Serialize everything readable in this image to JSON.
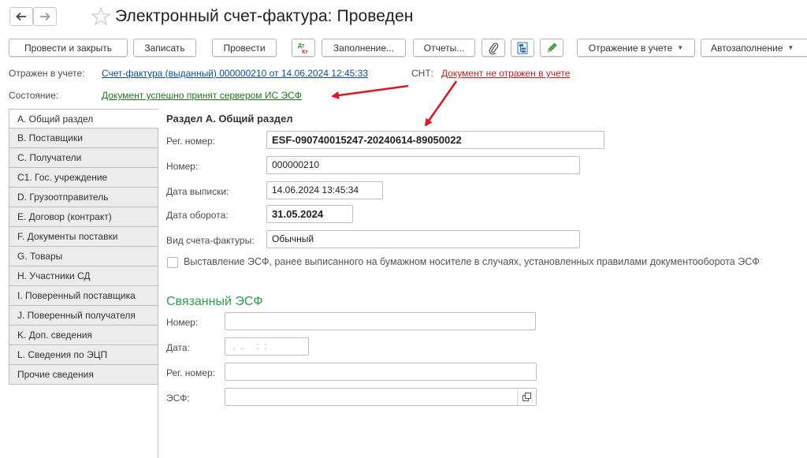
{
  "window": {
    "title": "Электронный счет-фактура: Проведен",
    "nav_back_icon": "arrow-left-icon",
    "nav_forward_icon": "arrow-right-icon",
    "favorite_icon": "star-icon"
  },
  "toolbar": {
    "post_close": "Провести и закрыть",
    "save": "Записать",
    "post": "Провести",
    "fill": "Заполнение...",
    "reports": "Отчеты...",
    "accounting": "Отражение в учете",
    "autofill": "Автозаполнение"
  },
  "status": {
    "reflected_label": "Отражен в учете:",
    "reflected_link": "Счет-фактура (выданный) 000000210 от 14.06.2024 12:45:33",
    "snt_label": "СНТ:",
    "snt_link": "Документ не отражен в учете",
    "state_label": "Состояние:",
    "state_link": "Документ успешно принят сервером ИС ЭСФ"
  },
  "tabs": [
    "A. Общий раздел",
    "B. Поставщики",
    "C. Получатели",
    "C1. Гос. учреждение",
    "D. Грузоотправитель",
    "E. Договор (контракт)",
    "F. Документы поставки",
    "G. Товары",
    "H. Участники СД",
    "I. Поверенный поставщика",
    "J. Поверенный получателя",
    "K. Доп. сведения",
    "L. Сведения по ЭЦП",
    "Прочие сведения"
  ],
  "section_a": {
    "heading": "Раздел А. Общий раздел",
    "reg_label": "Рег. номер:",
    "reg_value": "ESF-090740015247-20240614-89050022",
    "number_label": "Номер:",
    "number_value": "000000210",
    "issue_date_label": "Дата выписки:",
    "issue_date_value": "14.06.2024 13:45:34",
    "turnover_label": "Дата оборота:",
    "turnover_value": "31.05.2024",
    "type_label": "Вид счета-фактуры:",
    "type_value": "Обычный",
    "checkbox_label": "Выставление ЭСФ, ранее выписанного на бумажном носителе в случаях, установленных правилами документооборота ЭСФ",
    "checkbox_checked": false
  },
  "linked_esf": {
    "heading": "Связанный ЭСФ",
    "number_label": "Номер:",
    "number_value": "",
    "date_label": "Дата:",
    "date_value": " .  .     :  :",
    "reg_label": "Рег. номер:",
    "reg_value": "",
    "esf_label": "ЭСФ:",
    "esf_value": ""
  },
  "colors": {
    "annotation_arrow": "#e0141e",
    "link_blue": "#0a4fa0",
    "link_red": "#c32020",
    "link_green": "#1e7a1e",
    "heading_green": "#2f9e4f"
  }
}
